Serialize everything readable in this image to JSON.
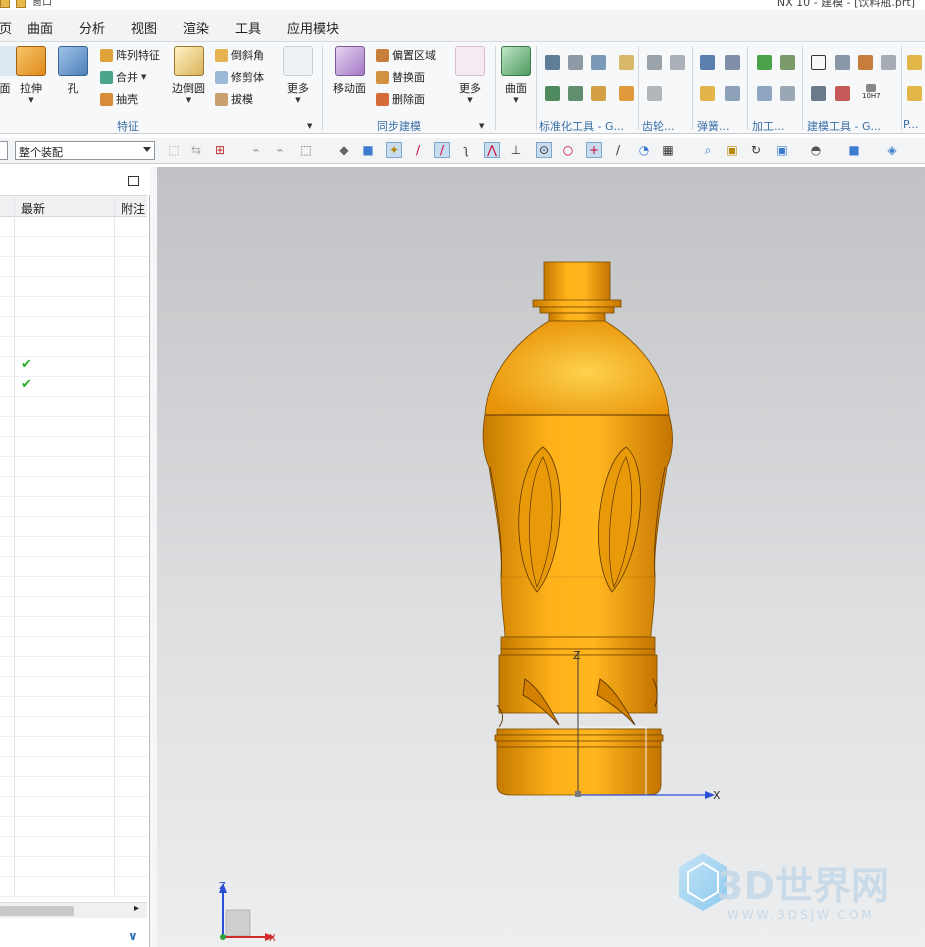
{
  "window": {
    "title": "NX 10 - 建模 - [饮料瓶.prt]",
    "quick_access_label": "窗口"
  },
  "menubar": {
    "items": [
      "主页",
      "曲面",
      "分析",
      "视图",
      "渲染",
      "工具",
      "应用模块"
    ]
  },
  "ribbon": {
    "feature_group": {
      "label": "特征",
      "big_buttons": [
        "面",
        "拉伸",
        "孔",
        "边倒圆",
        "更多"
      ],
      "small_buttons": [
        "阵列特征",
        "合并",
        "抽壳",
        "倒斜角",
        "修剪体",
        "拔模"
      ]
    },
    "sync_group": {
      "label": "同步建模",
      "big_buttons": [
        "移动面",
        "更多"
      ],
      "small_buttons": [
        "偏置区域",
        "替换面",
        "删除面"
      ]
    },
    "surface_button": "曲面",
    "group_labels": [
      "标准化工具 - G...",
      "齿轮...",
      "弹簧...",
      "加工...",
      "建模工具 - G...",
      "P..."
    ],
    "tolerance_badge": "10H7"
  },
  "toolbar": {
    "scope_value": "整个装配"
  },
  "navigator": {
    "columns": [
      "最新",
      "附注"
    ],
    "checkmark": "✔",
    "checked_rows": [
      7,
      8
    ]
  },
  "viewport": {
    "axis_labels": {
      "x": "X",
      "z": "Z"
    },
    "triad_labels": {
      "x": "X",
      "z": "Z"
    },
    "watermark": {
      "brand": "3D世界网",
      "url": "WWW.3DSJW.COM"
    },
    "model_color": "#f2a20a"
  }
}
